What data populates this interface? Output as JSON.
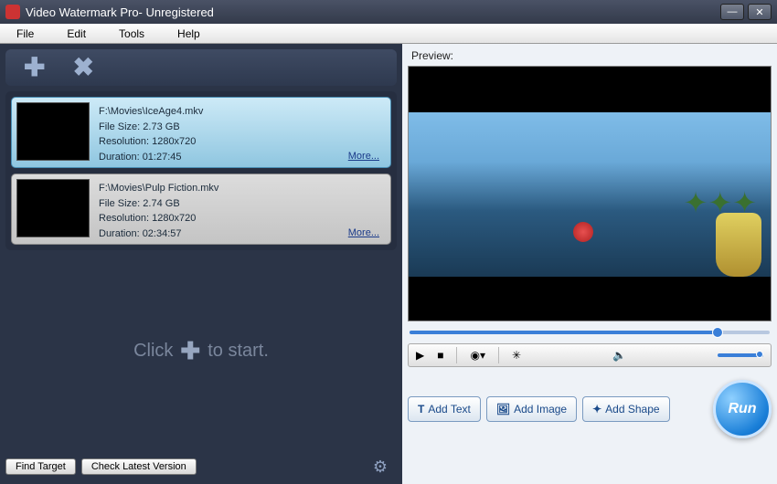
{
  "title": "Video Watermark Pro- Unregistered",
  "menu": {
    "file": "File",
    "edit": "Edit",
    "tools": "Tools",
    "help": "Help"
  },
  "toolbar": {
    "add": "✚",
    "remove": "✖"
  },
  "files": [
    {
      "path": "F:\\Movies\\IceAge4.mkv",
      "size": "File Size: 2.73 GB",
      "resolution": "Resolution: 1280x720",
      "duration": "Duration: 01:27:45",
      "more": "More...",
      "selected": true
    },
    {
      "path": "F:\\Movies\\Pulp Fiction.mkv",
      "size": "File Size: 2.74 GB",
      "resolution": "Resolution: 1280x720",
      "duration": "Duration: 02:34:57",
      "more": "More...",
      "selected": false
    }
  ],
  "hint": {
    "click": "Click",
    "tostart": "to start."
  },
  "bottom": {
    "findtarget": "Find Target",
    "checklatest": "Check Latest Version"
  },
  "preview": {
    "label": "Preview:"
  },
  "actions": {
    "addtext": "Add Text",
    "addimage": "Add Image",
    "addshape": "Add Shape",
    "run": "Run"
  }
}
